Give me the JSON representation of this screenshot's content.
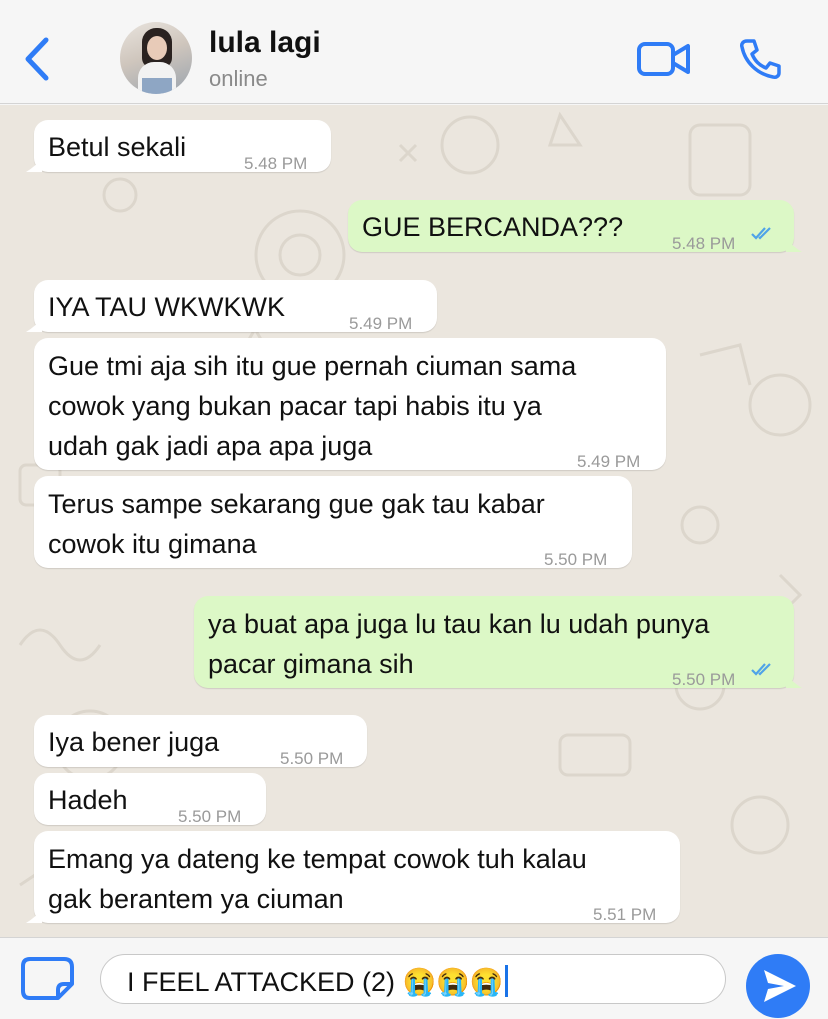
{
  "header": {
    "back_icon": "chevron-left-icon",
    "contact_name": "lula lagi",
    "status": "online",
    "video_icon": "video-camera-icon",
    "call_icon": "phone-icon",
    "accent_color": "#2f7cf6"
  },
  "messages": [
    {
      "direction": "incoming",
      "lines": [
        "Betul sekali"
      ],
      "time": "5.48 PM"
    },
    {
      "direction": "outgoing",
      "lines": [
        "GUE BERCANDA???"
      ],
      "time": "5.48 PM",
      "status_icon": "double-check-read-icon"
    },
    {
      "direction": "incoming",
      "lines": [
        "IYA TAU WKWKWK"
      ],
      "time": "5.49 PM"
    },
    {
      "direction": "incoming",
      "lines": [
        "Gue tmi aja sih itu gue pernah ciuman sama",
        "cowok yang bukan pacar tapi habis itu ya",
        "udah gak jadi apa apa juga"
      ],
      "time": "5.49 PM"
    },
    {
      "direction": "incoming",
      "lines": [
        "Terus sampe sekarang gue gak tau kabar",
        "cowok itu gimana"
      ],
      "time": "5.50 PM"
    },
    {
      "direction": "outgoing",
      "lines": [
        "ya buat apa juga lu tau kan lu udah punya",
        "pacar gimana sih"
      ],
      "time": "5.50 PM",
      "status_icon": "double-check-read-icon"
    },
    {
      "direction": "incoming",
      "lines": [
        "Iya bener juga"
      ],
      "time": "5.50 PM"
    },
    {
      "direction": "incoming",
      "lines": [
        "Hadeh"
      ],
      "time": "5.50 PM"
    },
    {
      "direction": "incoming",
      "lines": [
        "Emang ya dateng ke tempat cowok tuh kalau",
        "gak berantem ya ciuman"
      ],
      "time": "5.51 PM"
    }
  ],
  "composer": {
    "attach_icon": "sticker-icon",
    "input_value": "I FEEL ATTACKED (2) 😭😭😭",
    "send_icon": "send-arrow-icon"
  },
  "colors": {
    "incoming_bubble": "#ffffff",
    "outgoing_bubble": "#dcf8c6",
    "read_ticks": "#4fa3e8",
    "wallpaper": "#ebe6de"
  }
}
